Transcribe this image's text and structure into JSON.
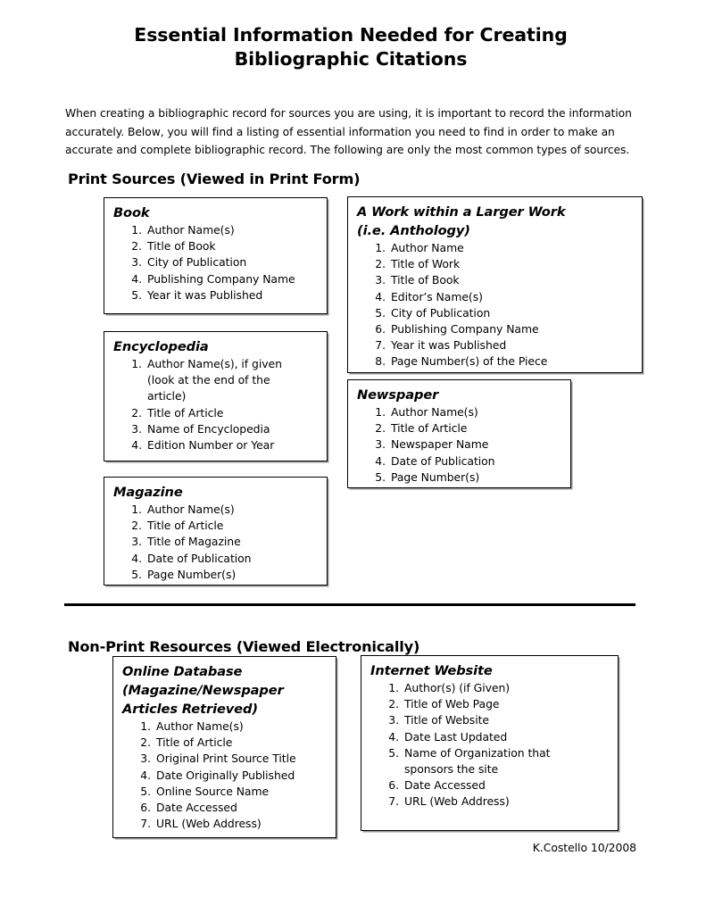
{
  "document": {
    "title_line1": "Essential Information Needed for Creating",
    "title_line2": "Bibliographic Citations",
    "intro": "When creating a bibliographic record for sources you are using, it is important to record the information accurately.  Below, you will find a listing of essential information you need to find in order to make an accurate and complete bibliographic record.  The following are only the most common types of sources.",
    "footer": "K.Costello 10/2008"
  },
  "sections": {
    "print": {
      "heading": "Print Sources (Viewed in Print Form)"
    },
    "nonprint": {
      "heading": "Non-Print Resources (Viewed Electronically)"
    }
  },
  "boxes": {
    "book": {
      "title": "Book",
      "items": [
        "Author Name(s)",
        "Title of Book",
        "City of Publication",
        "Publishing Company Name",
        "Year it was Published"
      ]
    },
    "encyclopedia": {
      "title": "Encyclopedia",
      "items": [
        "Author Name(s), if given",
        "Title of Article",
        "Name of Encyclopedia",
        "Edition Number or Year"
      ],
      "item1_cont_line1": "(look at the end of the",
      "item1_cont_line2": "article)"
    },
    "magazine": {
      "title": "Magazine",
      "items": [
        "Author Name(s)",
        "Title of Article",
        "Title of Magazine",
        "Date of Publication",
        "Page Number(s)"
      ]
    },
    "larger_work": {
      "title_line1": "A Work within a Larger Work",
      "title_line2": "(i.e. Anthology)",
      "items": [
        "Author Name",
        "Title of Work",
        "Title of Book",
        "Editor’s Name(s)",
        "City of Publication",
        "Publishing Company Name",
        "Year it was Published",
        "Page Number(s) of the Piece"
      ]
    },
    "newspaper": {
      "title": "Newspaper",
      "items": [
        "Author Name(s)",
        "Title of Article",
        "Newspaper Name",
        "Date of Publication",
        "Page Number(s)"
      ]
    },
    "online_database": {
      "title_line1": "Online Database",
      "title_line2": "(Magazine/Newspaper",
      "title_line3": "Articles Retrieved)",
      "items": [
        "Author Name(s)",
        "Title of Article",
        "Original Print Source Title",
        "Date Originally Published",
        "Online Source Name",
        "Date Accessed",
        "URL (Web Address)"
      ]
    },
    "internet_website": {
      "title": "Internet Website",
      "items": [
        "Author(s) (if Given)",
        "Title of Web Page",
        "Title of Website",
        "Date Last Updated",
        "Name of Organization that",
        "Date Accessed",
        "URL (Web Address)"
      ],
      "item5_cont": "sponsors the site"
    }
  },
  "colors": {
    "text": "#000000",
    "background": "#ffffff",
    "box_border": "#000000",
    "box_shadow": "#9a9a9a",
    "divider": "#000000"
  }
}
